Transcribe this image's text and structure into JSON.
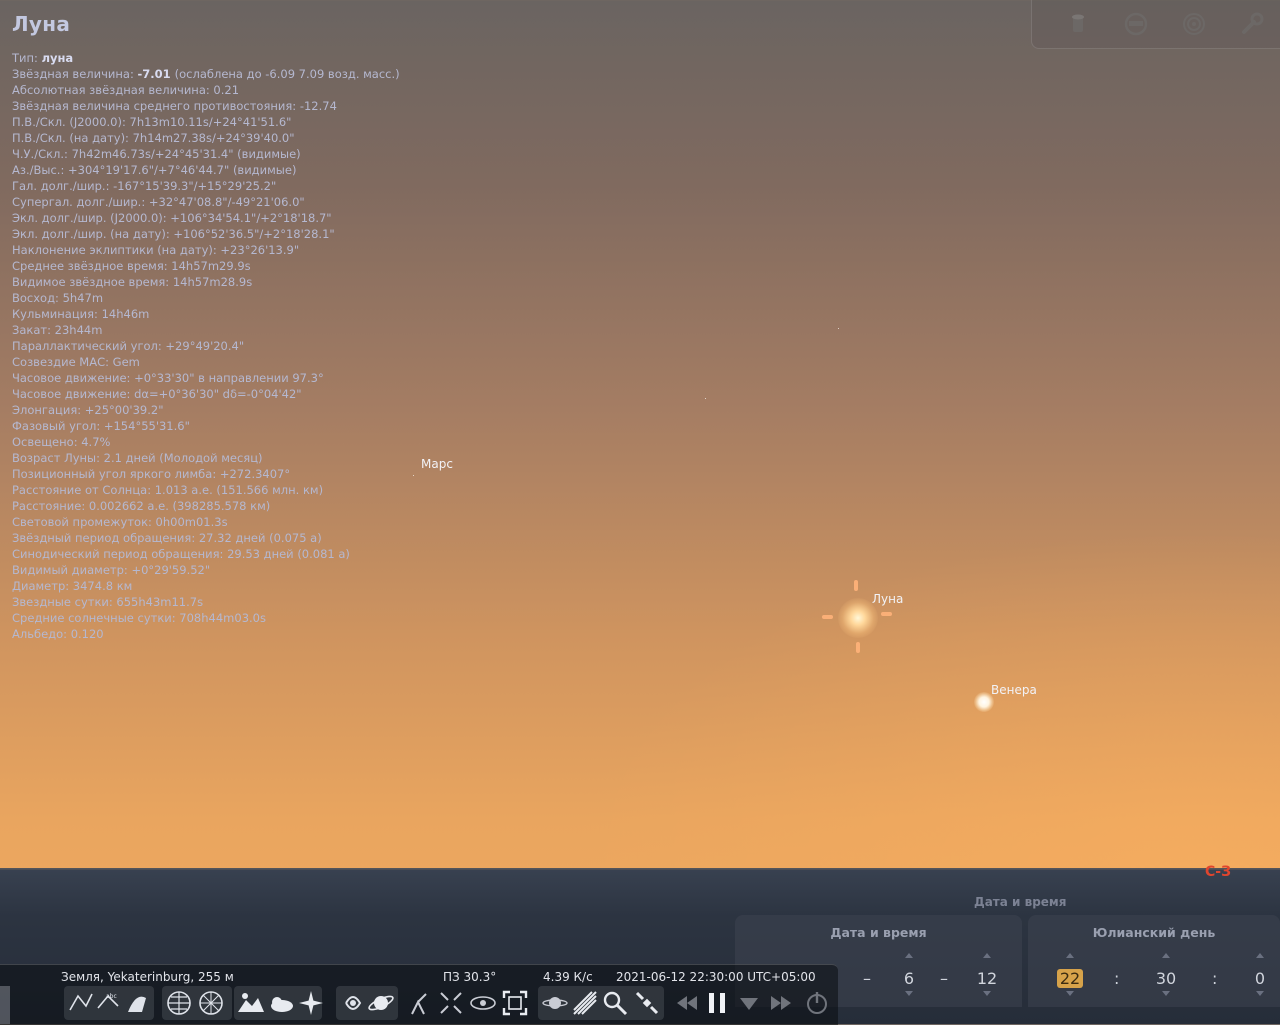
{
  "object": {
    "name": "Луна",
    "info_rows": [
      {
        "key": "Тип:",
        "bold": "луна",
        "rest": ""
      },
      {
        "key": "Звёздная величина:",
        "bold": "-7.01",
        "rest": "(ослаблена до -6.09 7.09 возд. масс.)"
      },
      {
        "key": "Абсолютная звёздная величина:",
        "bold": "",
        "rest": "0.21"
      },
      {
        "key": "Звёздная величина среднего противостояния:",
        "bold": "",
        "rest": "-12.74"
      },
      {
        "key": "П.В./Скл. (J2000.0):",
        "bold": "",
        "rest": "7h13m10.11s/+24°41'51.6\""
      },
      {
        "key": "П.В./Скл. (на дату):",
        "bold": "",
        "rest": "7h14m27.38s/+24°39'40.0\""
      },
      {
        "key": "Ч.У./Скл.:",
        "bold": "",
        "rest": "7h42m46.73s/+24°45'31.4\" (видимые)"
      },
      {
        "key": "Аз./Выс.:",
        "bold": "",
        "rest": "+304°19'17.6\"/+7°46'44.7\" (видимые)"
      },
      {
        "key": "Гал. долг./шир.:",
        "bold": "",
        "rest": "-167°15'39.3\"/+15°29'25.2\""
      },
      {
        "key": "Супергал. долг./шир.:",
        "bold": "",
        "rest": "+32°47'08.8\"/-49°21'06.0\""
      },
      {
        "key": "Экл. долг./шир. (J2000.0):",
        "bold": "",
        "rest": "+106°34'54.1\"/+2°18'18.7\""
      },
      {
        "key": "Экл. долг./шир. (на дату):",
        "bold": "",
        "rest": "+106°52'36.5\"/+2°18'28.1\""
      },
      {
        "key": "Наклонение эклиптики (на дату):",
        "bold": "",
        "rest": "+23°26'13.9\""
      },
      {
        "key": "Среднее звёздное время:",
        "bold": "",
        "rest": "14h57m29.9s"
      },
      {
        "key": "Видимое звёздное время:",
        "bold": "",
        "rest": "14h57m28.9s"
      },
      {
        "key": "Восход:",
        "bold": "",
        "rest": "5h47m"
      },
      {
        "key": "Кульминация:",
        "bold": "",
        "rest": "14h46m"
      },
      {
        "key": "Закат:",
        "bold": "",
        "rest": "23h44m"
      },
      {
        "key": "Параллактический угол:",
        "bold": "",
        "rest": "+29°49'20.4\""
      },
      {
        "key": "Созвездие МАС:",
        "bold": "",
        "rest": "Gem"
      },
      {
        "key": "Часовое движение:",
        "bold": "",
        "rest": "+0°33'30\" в направлении 97.3°"
      },
      {
        "key": "Часовое движение:",
        "bold": "",
        "rest": "dα=+0°36'30\" dδ=-0°04'42\""
      },
      {
        "key": "Элонгация:",
        "bold": "",
        "rest": "+25°00'39.2\""
      },
      {
        "key": "Фазовый угол:",
        "bold": "",
        "rest": "+154°55'31.6\""
      },
      {
        "key": "Освещено:",
        "bold": "",
        "rest": "4.7%"
      },
      {
        "key": "Возраст Луны:",
        "bold": "",
        "rest": "2.1 дней (Молодой месяц)"
      },
      {
        "key": "Позиционный угол яркого лимба:",
        "bold": "",
        "rest": "+272.3407°"
      },
      {
        "key": "Расстояние от Солнца:",
        "bold": "",
        "rest": "1.013 а.е. (151.566 млн. км)"
      },
      {
        "key": "Расстояние:",
        "bold": "",
        "rest": "0.002662 а.е. (398285.578 км)"
      },
      {
        "key": "Световой промежуток:",
        "bold": "",
        "rest": "0h00m01.3s"
      },
      {
        "key": "Звёздный период обращения:",
        "bold": "",
        "rest": "27.32 дней (0.075 a)"
      },
      {
        "key": "Синодический период обращения:",
        "bold": "",
        "rest": "29.53 дней (0.081 a)"
      },
      {
        "key": "Видимый диаметр:",
        "bold": "",
        "rest": "+0°29'59.52\""
      },
      {
        "key": "Диаметр:",
        "bold": "",
        "rest": "3474.8 км"
      },
      {
        "key": "Звездные сутки:",
        "bold": "",
        "rest": "655h43m11.7s"
      },
      {
        "key": "Средние солнечные сутки:",
        "bold": "",
        "rest": "708h44m03.0s"
      },
      {
        "key": "Альбедо:",
        "bold": "",
        "rest": "0.120"
      }
    ]
  },
  "sky_labels": {
    "mars": "Марс",
    "moon": "Луна",
    "venus": "Венера"
  },
  "compass": "С-З",
  "datetime_panel": {
    "caption": "Дата и время",
    "date_time_title": "Дата и время",
    "julian_title": "Юлианский день",
    "date_sep1": "–",
    "month": "6",
    "date_sep2": "–",
    "day": "12",
    "hour": "22",
    "time_sep1": ":",
    "minute": "30",
    "time_sep2": ":",
    "second": "0"
  },
  "status_bar": {
    "location": "Земля, Yekaterinburg, 255 м",
    "fov": "ПЗ 30.3°",
    "fps": "4.39 К/с",
    "datetime": "2021-06-12 22:30:00 UTC+05:00"
  },
  "colors": {
    "sky_top": "#6a6461",
    "sky_bottom": "#f4ac60",
    "ground": "#2c3441",
    "info_text": "#b5b8d0",
    "compass": "#e0452e"
  },
  "toolbar_icons": [
    "constellation-lines-icon",
    "constellation-labels-icon",
    "constellation-art-icon",
    "equatorial-grid-icon",
    "azimuthal-grid-icon",
    "ground-icon",
    "atmosphere-icon",
    "cardinal-points-icon",
    "nebulae-icon",
    "planets-icon",
    "mount-icon",
    "center-object-icon",
    "night-mode-icon",
    "fullscreen-icon",
    "exoplanets-icon",
    "meteor-showers-icon",
    "search-icon",
    "satellites-icon",
    "rewind-icon",
    "pause-icon",
    "set-time-now-icon",
    "fast-forward-icon",
    "quit-icon"
  ]
}
